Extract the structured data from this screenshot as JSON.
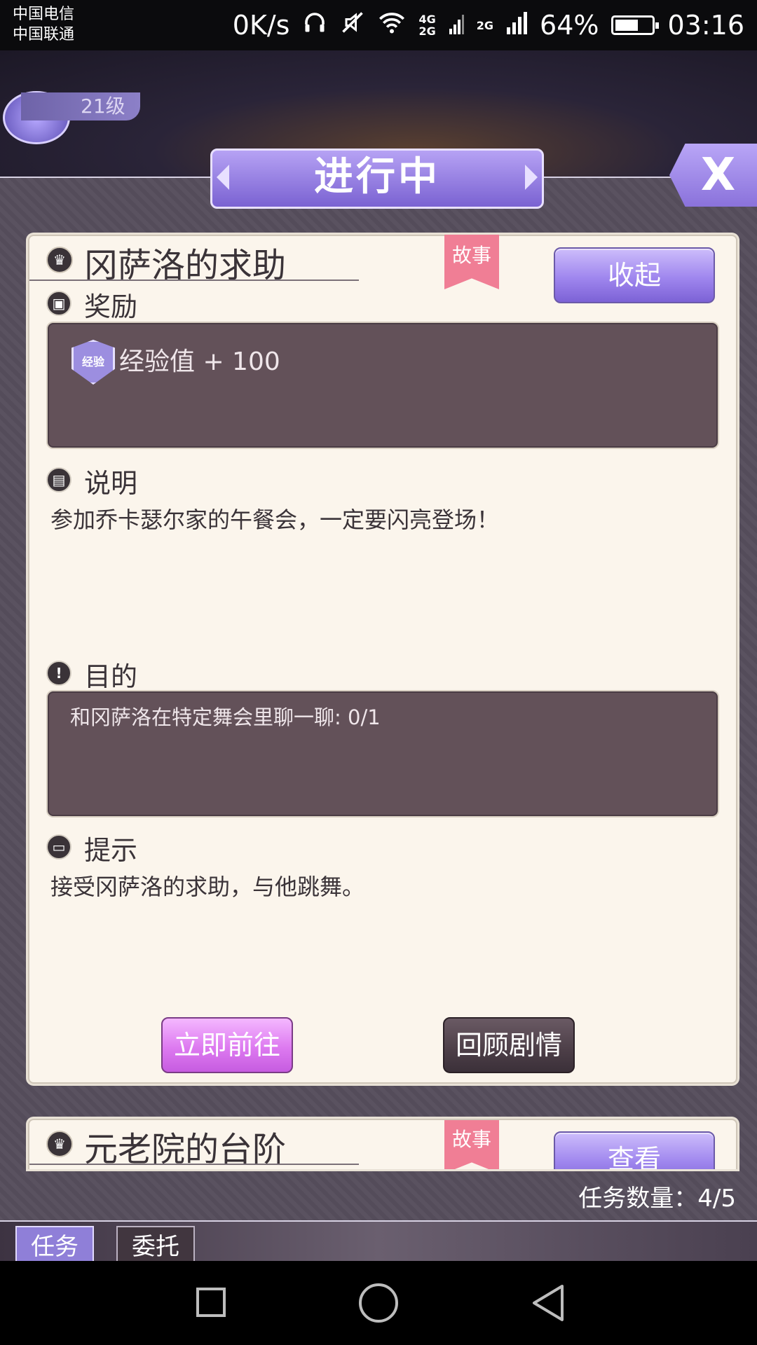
{
  "status_bar": {
    "carrier1": "中国电信",
    "carrier2": "中国联通",
    "net_speed": "0K/s",
    "net_type_1": "4G",
    "net_type_2": "2G",
    "net_type_3": "2G",
    "battery": "64%",
    "battery_level": 0.64,
    "time": "03:16"
  },
  "header": {
    "level": "21级",
    "title": "进行中",
    "close_label": "X"
  },
  "quest1": {
    "title": "冈萨洛的求助",
    "tag": "故事",
    "collapse_label": "收起",
    "reward_heading": "奖励",
    "reward_badge": "经验",
    "reward_text": "经验值 + 100",
    "desc_heading": "说明",
    "desc_text": "参加乔卡瑟尔家的午餐会，一定要闪亮登场！",
    "objective_heading": "目的",
    "objective_text": "和冈萨洛在特定舞会里聊一聊: 0/1",
    "hint_heading": "提示",
    "hint_text": "接受冈萨洛的求助，与他跳舞。",
    "go_label": "立即前往",
    "review_label": "回顾剧情"
  },
  "quest2": {
    "title": "元老院的台阶",
    "tag": "故事",
    "view_label": "查看"
  },
  "footer": {
    "count_text": "任务数量：4/5"
  },
  "tabs": [
    {
      "label": "任务"
    },
    {
      "label": "委托"
    }
  ],
  "colors": {
    "accent_purple": "#8f7fd8",
    "story_pink": "#f07e95",
    "go_button": "#dd7af0"
  }
}
